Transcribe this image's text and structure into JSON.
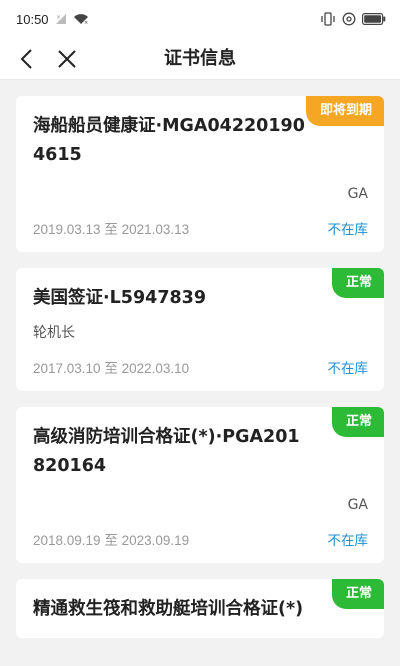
{
  "status_bar": {
    "time": "10:50",
    "icons": [
      "sim-no-signal-icon",
      "wifi-icon",
      "vibrate-icon",
      "at-icon",
      "battery-icon"
    ]
  },
  "nav": {
    "title": "证书信息",
    "back_icon": "back-arrow-icon",
    "close_icon": "close-icon"
  },
  "colors": {
    "expiring": "#f5a623",
    "normal": "#2dbb37",
    "link": "#1f8fd6"
  },
  "certificates": [
    {
      "title": "海船船员健康证·MGA042201904615",
      "badge": "即将到期",
      "badge_type": "expiring",
      "sub": "GA",
      "sub_align": "right",
      "date_range": "2019.03.13 至 2021.03.13",
      "status": "不在库"
    },
    {
      "title": "美国签证·L5947839",
      "badge": "正常",
      "badge_type": "normal",
      "sub": "轮机长",
      "sub_align": "left",
      "date_range": "2017.03.10 至 2022.03.10",
      "status": "不在库"
    },
    {
      "title": "高级消防培训合格证(*)·PGA201820164",
      "badge": "正常",
      "badge_type": "normal",
      "sub": "GA",
      "sub_align": "right",
      "date_range": "2018.09.19 至 2023.09.19",
      "status": "不在库"
    },
    {
      "title": "精通救生筏和救助艇培训合格证(*)",
      "badge": "正常",
      "badge_type": "normal",
      "sub": "",
      "sub_align": "right",
      "date_range": "",
      "status": ""
    }
  ]
}
